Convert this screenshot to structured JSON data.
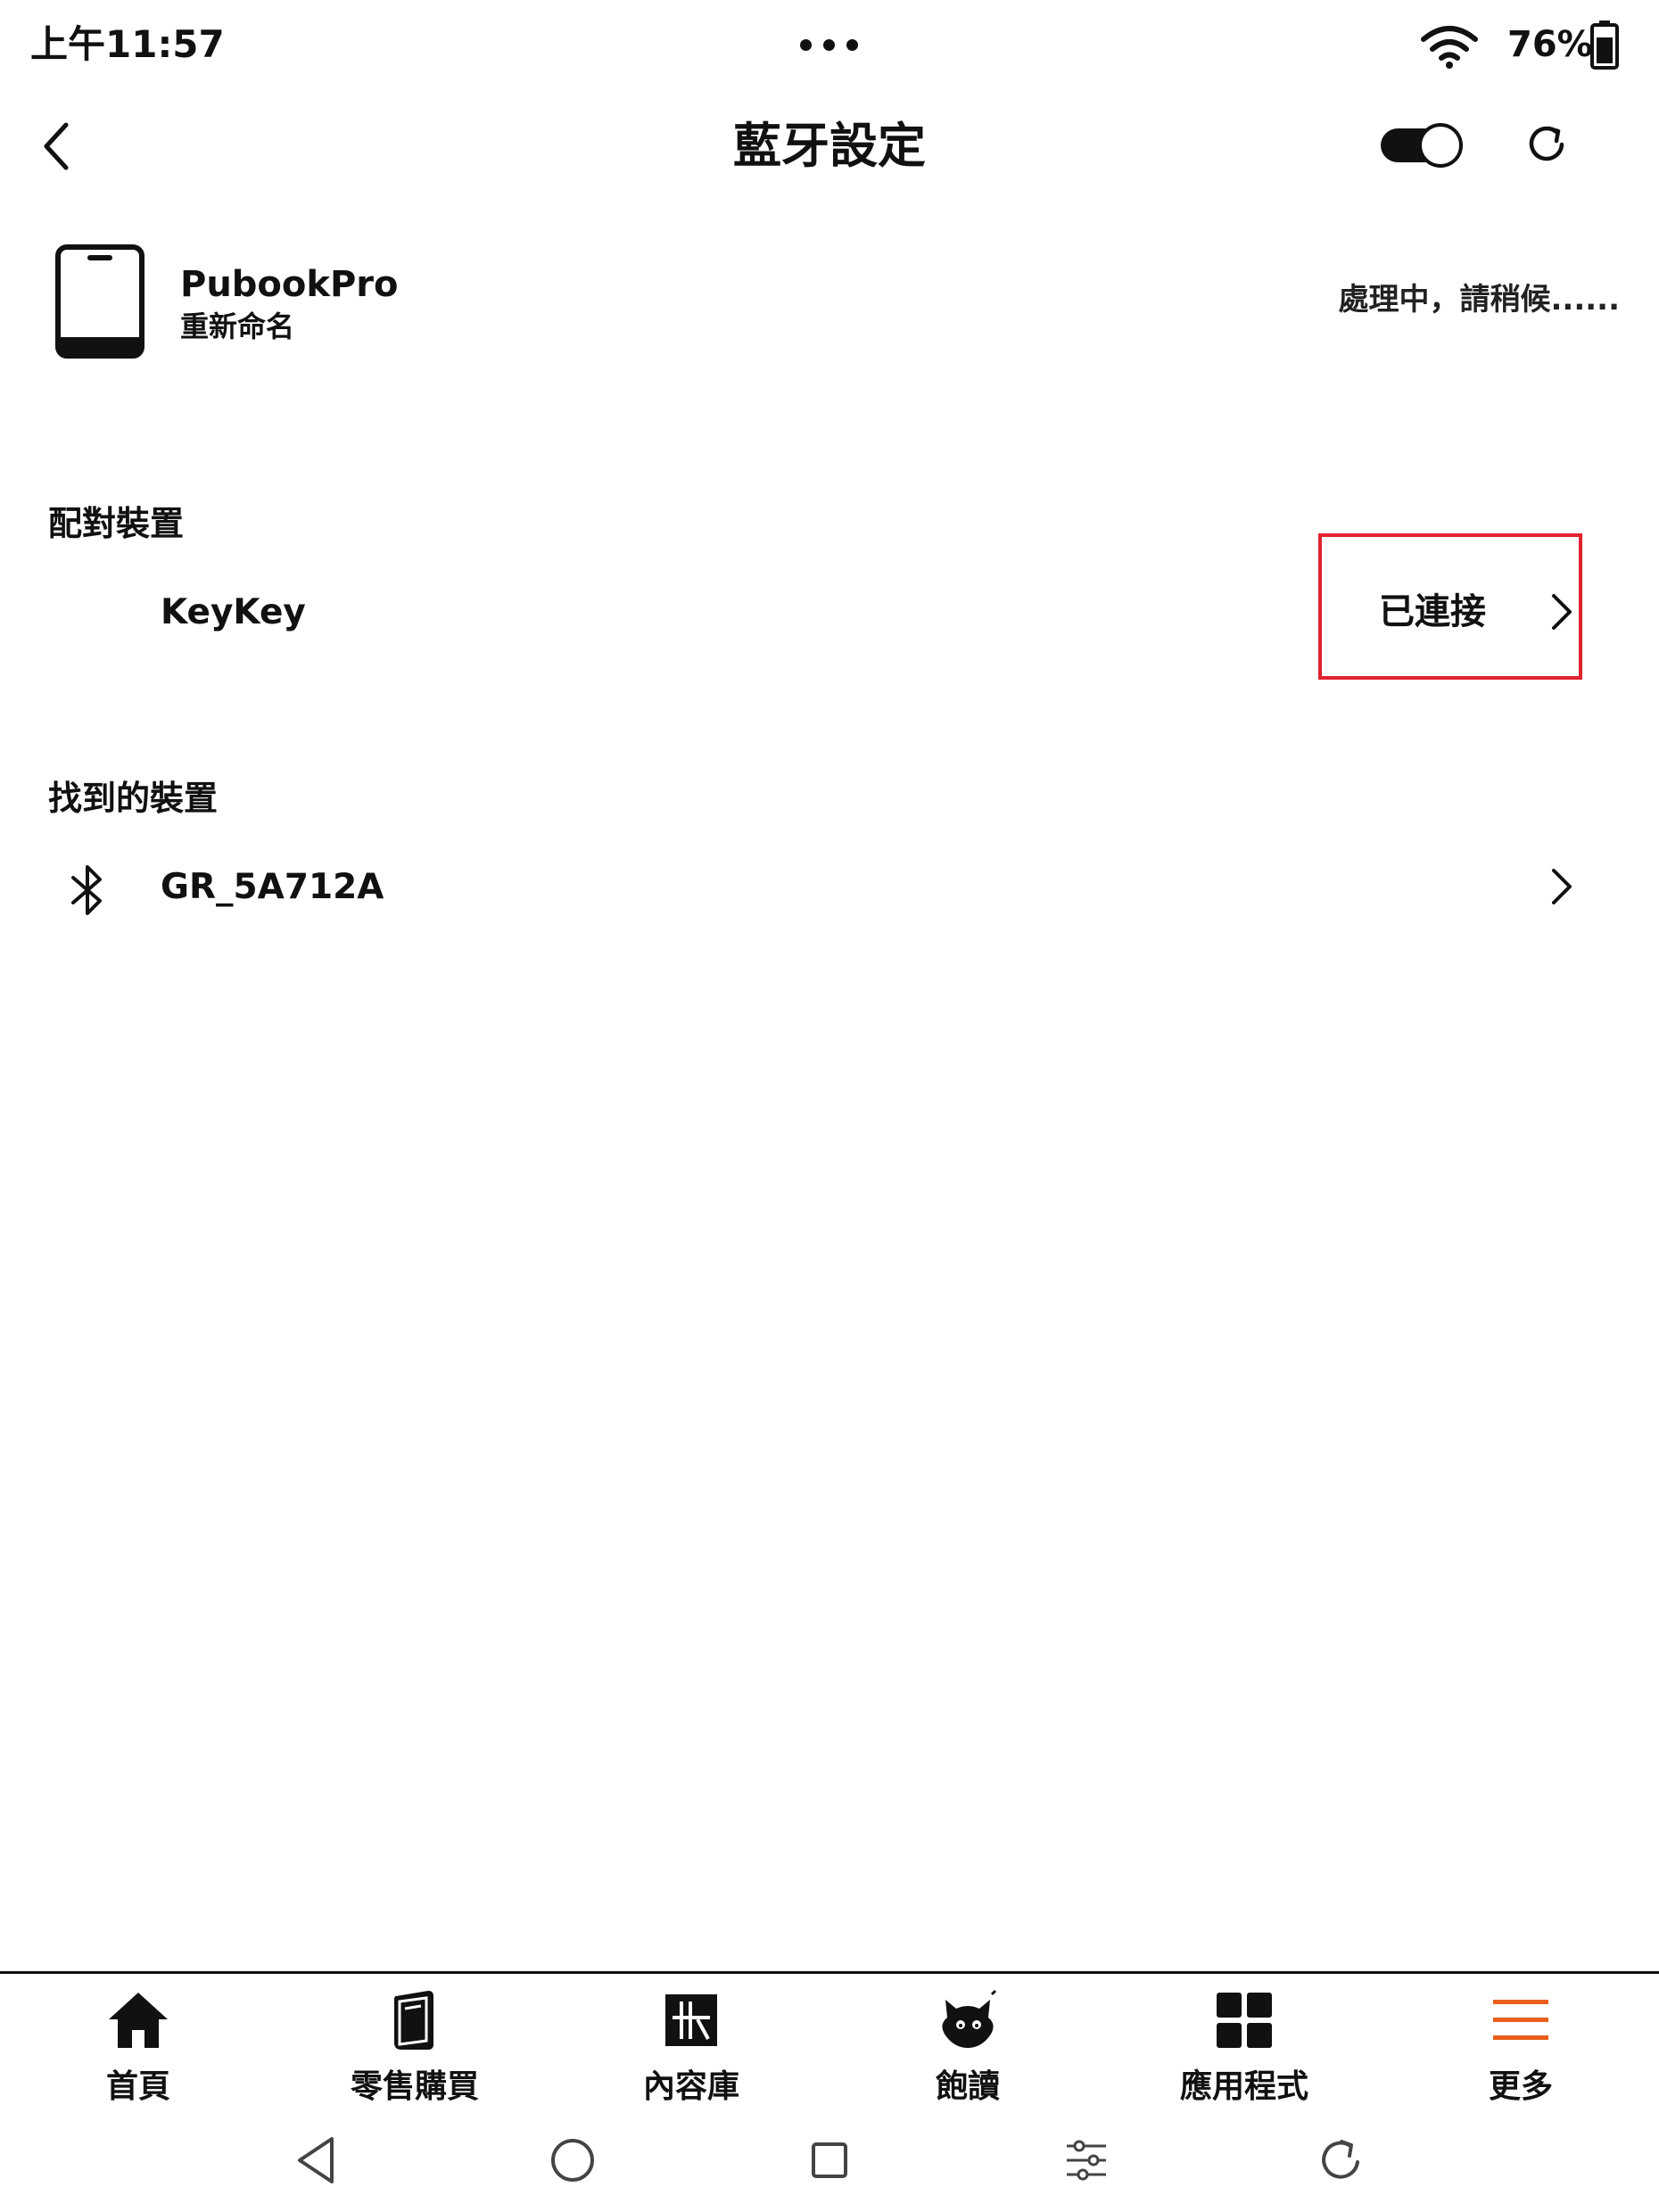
{
  "status_bar": {
    "time": "上午11:57",
    "battery_percent": "76%"
  },
  "header": {
    "title": "藍牙設定",
    "bluetooth_toggle_on": true
  },
  "device": {
    "name": "PubookPro",
    "rename_label": "重新命名",
    "status_text": "處理中，請稍候......"
  },
  "paired_section": {
    "title": "配對裝置",
    "items": [
      {
        "name": "KeyKey",
        "status": "已連接"
      }
    ]
  },
  "found_section": {
    "title": "找到的裝置",
    "items": [
      {
        "name": "GR_5A712A",
        "icon": "bluetooth-icon"
      }
    ]
  },
  "bottom_nav": {
    "items": [
      {
        "label": "首頁",
        "icon": "home-icon"
      },
      {
        "label": "零售購買",
        "icon": "book-icon"
      },
      {
        "label": "內容庫",
        "icon": "library-icon"
      },
      {
        "label": "飽讀",
        "icon": "mascot-icon"
      },
      {
        "label": "應用程式",
        "icon": "apps-grid-icon"
      },
      {
        "label": "更多",
        "icon": "menu-icon"
      }
    ],
    "active_index": 5,
    "accent_color": "#e8601c"
  },
  "highlight_color": "#e0222e"
}
